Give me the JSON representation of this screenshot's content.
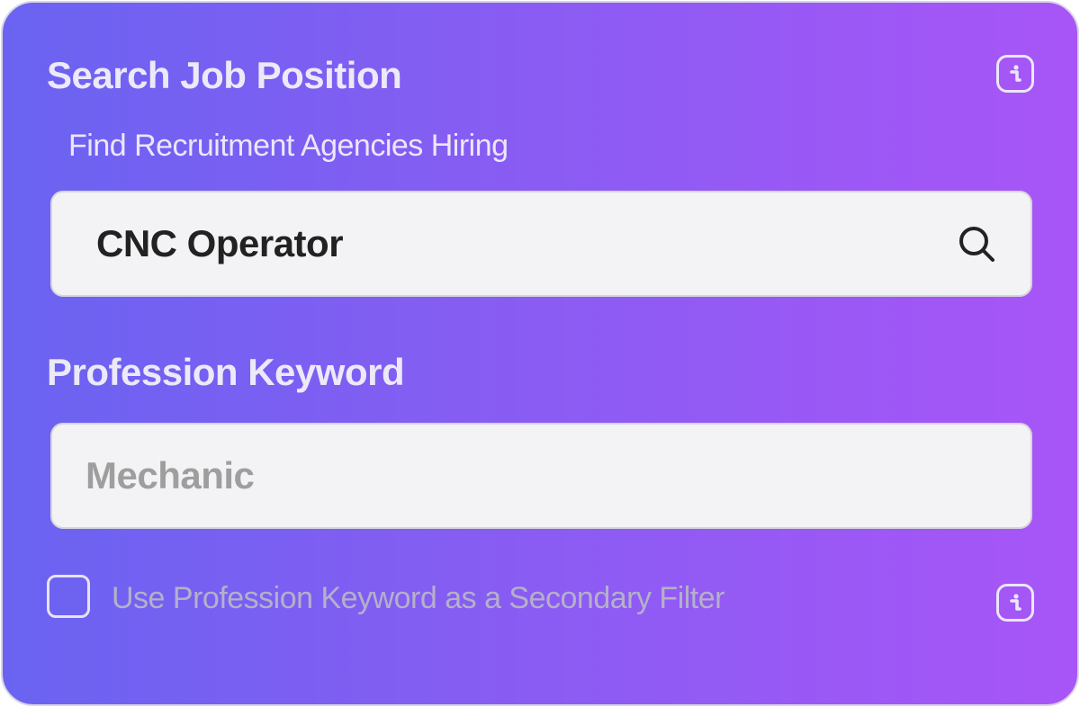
{
  "header": {
    "title": "Search Job Position",
    "subtitle": "Find Recruitment Agencies Hiring",
    "info_icon": "info-icon"
  },
  "search": {
    "value": "CNC Operator",
    "icon": "search-icon"
  },
  "keyword": {
    "label": "Profession Keyword",
    "placeholder": "Mechanic",
    "value": ""
  },
  "filter": {
    "checkbox_label": "Use Profession Keyword as a Secondary Filter",
    "checked": false,
    "info_icon": "info-icon"
  },
  "colors": {
    "gradient_start": "#6a63f1",
    "gradient_end": "#a855f7",
    "input_background": "#f3f3f5"
  }
}
